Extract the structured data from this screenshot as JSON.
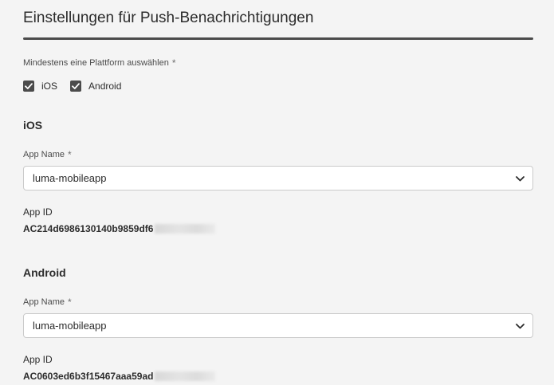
{
  "page": {
    "title": "Einstellungen für Push-Benachrichtigungen"
  },
  "platform_select": {
    "label": "Mindestens eine Plattform auswählen",
    "required_marker": "*",
    "options": [
      {
        "label": "iOS",
        "checked": true
      },
      {
        "label": "Android",
        "checked": true
      }
    ]
  },
  "ios": {
    "heading": "iOS",
    "app_name_label": "App Name",
    "required_marker": "*",
    "app_name_value": "luma-mobileapp",
    "app_id_label": "App ID",
    "app_id_value": "AC214d6986130140b9859df6"
  },
  "android": {
    "heading": "Android",
    "app_name_label": "App Name",
    "required_marker": "*",
    "app_name_value": "luma-mobileapp",
    "app_id_label": "App ID",
    "app_id_value": "AC0603ed6b3f15467aaa59ad"
  },
  "colors": {
    "background": "#f4f4f4",
    "text": "#2c2c2c",
    "checkbox_fill": "#4b4b4b",
    "field_border": "#cacaca"
  },
  "icons": {
    "checkmark": "checkmark-icon",
    "dropdown": "chevron-down-icon",
    "required": "asterisk-icon"
  }
}
